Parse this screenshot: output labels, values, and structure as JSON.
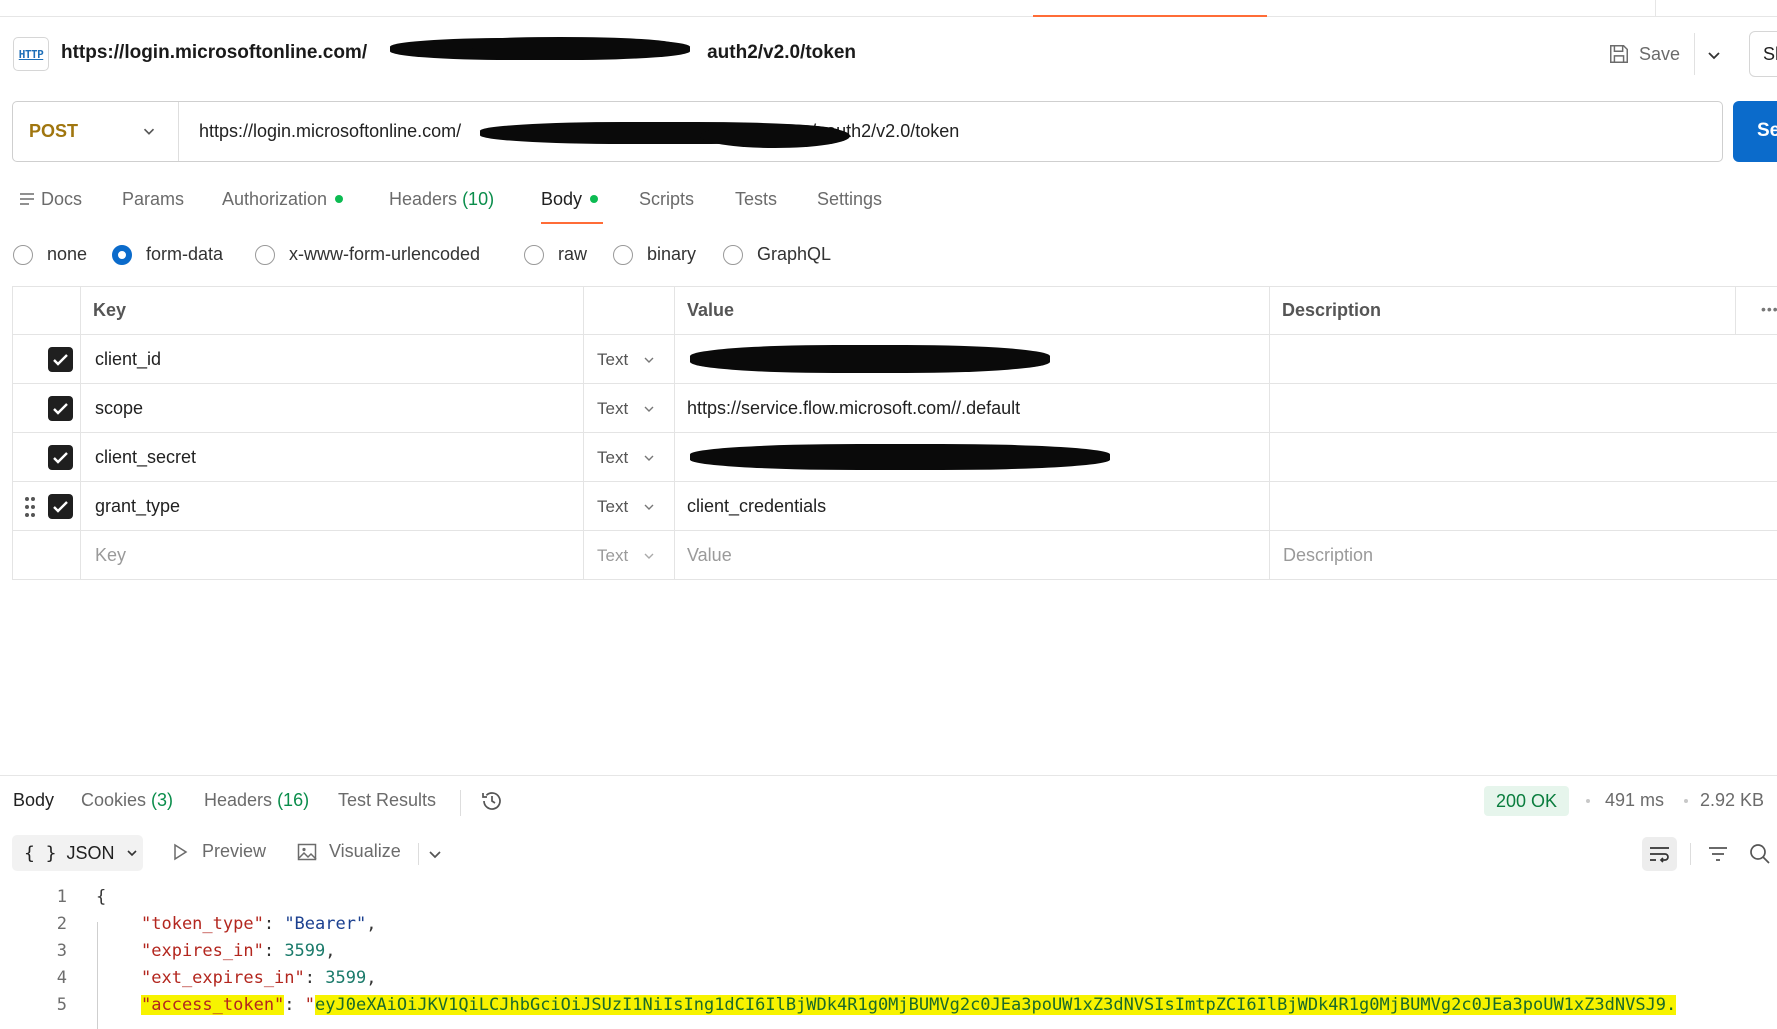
{
  "request": {
    "title_prefix": "https://login.microsoftonline.com/",
    "title_suffix": "auth2/v2.0/token",
    "save_label": "Save",
    "share_label": "Sh",
    "method": "POST",
    "url_prefix": "https://login.microsoftonline.com/",
    "url_suffix": "/oauth2/v2.0/token",
    "send_label": "Se"
  },
  "tabs": [
    {
      "label": "Docs"
    },
    {
      "label": "Params"
    },
    {
      "label": "Authorization"
    },
    {
      "label": "Headers",
      "count": "(10)"
    },
    {
      "label": "Body"
    },
    {
      "label": "Scripts"
    },
    {
      "label": "Tests"
    },
    {
      "label": "Settings"
    }
  ],
  "body_modes": [
    "none",
    "form-data",
    "x-www-form-urlencoded",
    "raw",
    "binary",
    "GraphQL"
  ],
  "body_mode_selected": "form-data",
  "params": {
    "headers": {
      "key": "Key",
      "value": "Value",
      "description": "Description"
    },
    "rows": [
      {
        "key": "client_id",
        "type": "Text",
        "value": "",
        "checked": true
      },
      {
        "key": "scope",
        "type": "Text",
        "value": "https://service.flow.microsoft.com//.default",
        "checked": true
      },
      {
        "key": "client_secret",
        "type": "Text",
        "value": "",
        "checked": true
      },
      {
        "key": "grant_type",
        "type": "Text",
        "value": "client_credentials",
        "checked": true
      }
    ],
    "placeholder": {
      "key": "Key",
      "type": "Text",
      "value": "Value",
      "description": "Description"
    }
  },
  "response": {
    "tabs": [
      {
        "label": "Body"
      },
      {
        "label": "Cookies",
        "count": "(3)"
      },
      {
        "label": "Headers",
        "count": "(16)"
      },
      {
        "label": "Test Results"
      }
    ],
    "status": "200 OK",
    "time": "491 ms",
    "size": "2.92 KB",
    "format": "JSON",
    "preview_label": "Preview",
    "visualize_label": "Visualize",
    "lines": {
      "l1": "1",
      "l2": "2",
      "l3": "3",
      "l4": "4",
      "l5": "5",
      "open": "{",
      "token_type_key": "\"token_type\"",
      "token_type_val": "\"Bearer\"",
      "expires_in_key": "\"expires_in\"",
      "expires_in_val": "3599",
      "ext_expires_in_key": "\"ext_expires_in\"",
      "ext_expires_in_val": "3599",
      "access_token_key": "\"access_token\"",
      "access_token_quote": "\"",
      "access_token_val": "eyJ0eXAiOiJKV1QiLCJhbGciOiJSUzI1NiIsIng1dCI6IlBjWDk4R1g0MjBUMVg2c0JEa3poUW1xZ3dNVSIsImtpZCI6IlBjWDk4R1g0MjBUMVg2c0JEa3poUW1xZ3dNVSJ9."
    }
  },
  "colors": {
    "accent_orange": "#ff6c37",
    "primary_blue": "#0b6bcb",
    "status_green": "#0a7d3e",
    "method_post": "#a0760f",
    "highlight_yellow": "#f7f300"
  }
}
